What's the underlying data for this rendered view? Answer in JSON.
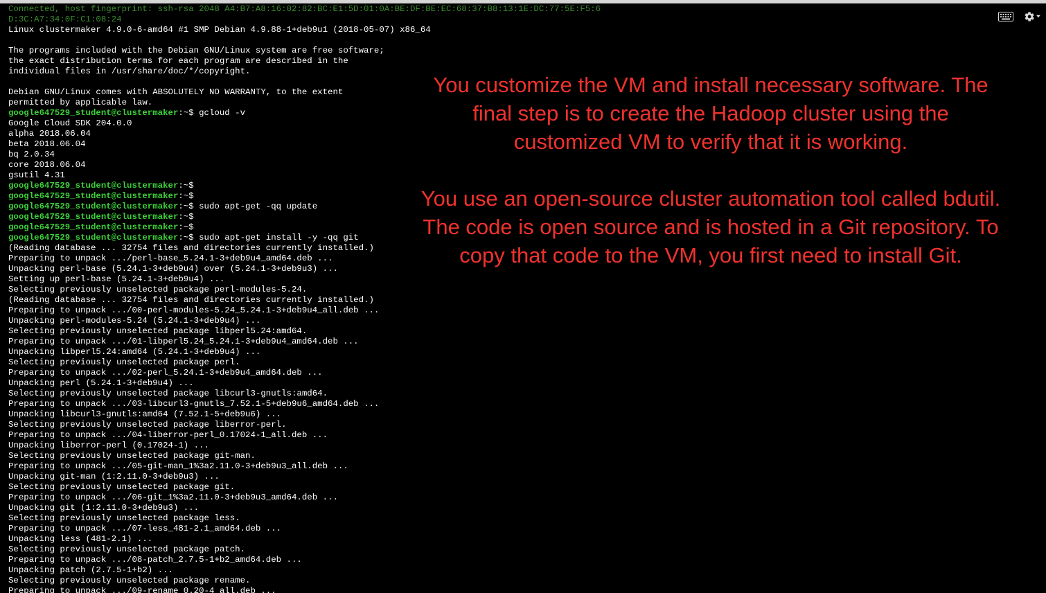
{
  "toolbar": {
    "keyboard_icon": "keyboard-icon",
    "settings_icon": "gear-icon"
  },
  "colors": {
    "background": "#000000",
    "terminal_text": "#ffffff",
    "prompt_user": "#3dd13a",
    "connection_text": "#3c8c2e",
    "overlay_text": "#f0322e"
  },
  "terminal": {
    "lines": [
      {
        "type": "conn",
        "text": "Connected, host fingerprint: ssh-rsa 2048 A4:B7:A8:16:02:82:BC:E1:5D:01:0A:BE:DF:BE:EC:68:37:B8:13:1E:DC:77:5E:F5:6"
      },
      {
        "type": "conn",
        "text": "D:3C:A7:34:0F:C1:08:24"
      },
      {
        "type": "out",
        "text": "Linux clustermaker 4.9.0-6-amd64 #1 SMP Debian 4.9.88-1+deb9u1 (2018-05-07) x86_64"
      },
      {
        "type": "out",
        "text": ""
      },
      {
        "type": "out",
        "text": "The programs included with the Debian GNU/Linux system are free software;"
      },
      {
        "type": "out",
        "text": "the exact distribution terms for each program are described in the"
      },
      {
        "type": "out",
        "text": "individual files in /usr/share/doc/*/copyright."
      },
      {
        "type": "out",
        "text": ""
      },
      {
        "type": "out",
        "text": "Debian GNU/Linux comes with ABSOLUTELY NO WARRANTY, to the extent"
      },
      {
        "type": "out",
        "text": "permitted by applicable law."
      },
      {
        "type": "prompt",
        "user": "google647529_student@clustermaker",
        "sep": ":~$",
        "cmd": " gcloud -v"
      },
      {
        "type": "out",
        "text": "Google Cloud SDK 204.0.0"
      },
      {
        "type": "out",
        "text": "alpha 2018.06.04"
      },
      {
        "type": "out",
        "text": "beta 2018.06.04"
      },
      {
        "type": "out",
        "text": "bq 2.0.34"
      },
      {
        "type": "out",
        "text": "core 2018.06.04"
      },
      {
        "type": "out",
        "text": "gsutil 4.31"
      },
      {
        "type": "prompt",
        "user": "google647529_student@clustermaker",
        "sep": ":~$",
        "cmd": ""
      },
      {
        "type": "prompt",
        "user": "google647529_student@clustermaker",
        "sep": ":~$",
        "cmd": ""
      },
      {
        "type": "prompt",
        "user": "google647529_student@clustermaker",
        "sep": ":~$",
        "cmd": " sudo apt-get -qq update"
      },
      {
        "type": "prompt",
        "user": "google647529_student@clustermaker",
        "sep": ":~$",
        "cmd": ""
      },
      {
        "type": "prompt",
        "user": "google647529_student@clustermaker",
        "sep": ":~$",
        "cmd": ""
      },
      {
        "type": "prompt",
        "user": "google647529_student@clustermaker",
        "sep": ":~$",
        "cmd": " sudo apt-get install -y -qq git"
      },
      {
        "type": "out",
        "text": "(Reading database ... 32754 files and directories currently installed.)"
      },
      {
        "type": "out",
        "text": "Preparing to unpack .../perl-base_5.24.1-3+deb9u4_amd64.deb ..."
      },
      {
        "type": "out",
        "text": "Unpacking perl-base (5.24.1-3+deb9u4) over (5.24.1-3+deb9u3) ..."
      },
      {
        "type": "out",
        "text": "Setting up perl-base (5.24.1-3+deb9u4) ..."
      },
      {
        "type": "out",
        "text": "Selecting previously unselected package perl-modules-5.24."
      },
      {
        "type": "out",
        "text": "(Reading database ... 32754 files and directories currently installed.)"
      },
      {
        "type": "out",
        "text": "Preparing to unpack .../00-perl-modules-5.24_5.24.1-3+deb9u4_all.deb ..."
      },
      {
        "type": "out",
        "text": "Unpacking perl-modules-5.24 (5.24.1-3+deb9u4) ..."
      },
      {
        "type": "out",
        "text": "Selecting previously unselected package libperl5.24:amd64."
      },
      {
        "type": "out",
        "text": "Preparing to unpack .../01-libperl5.24_5.24.1-3+deb9u4_amd64.deb ..."
      },
      {
        "type": "out",
        "text": "Unpacking libperl5.24:amd64 (5.24.1-3+deb9u4) ..."
      },
      {
        "type": "out",
        "text": "Selecting previously unselected package perl."
      },
      {
        "type": "out",
        "text": "Preparing to unpack .../02-perl_5.24.1-3+deb9u4_amd64.deb ..."
      },
      {
        "type": "out",
        "text": "Unpacking perl (5.24.1-3+deb9u4) ..."
      },
      {
        "type": "out",
        "text": "Selecting previously unselected package libcurl3-gnutls:amd64."
      },
      {
        "type": "out",
        "text": "Preparing to unpack .../03-libcurl3-gnutls_7.52.1-5+deb9u6_amd64.deb ..."
      },
      {
        "type": "out",
        "text": "Unpacking libcurl3-gnutls:amd64 (7.52.1-5+deb9u6) ..."
      },
      {
        "type": "out",
        "text": "Selecting previously unselected package liberror-perl."
      },
      {
        "type": "out",
        "text": "Preparing to unpack .../04-liberror-perl_0.17024-1_all.deb ..."
      },
      {
        "type": "out",
        "text": "Unpacking liberror-perl (0.17024-1) ..."
      },
      {
        "type": "out",
        "text": "Selecting previously unselected package git-man."
      },
      {
        "type": "out",
        "text": "Preparing to unpack .../05-git-man_1%3a2.11.0-3+deb9u3_all.deb ..."
      },
      {
        "type": "out",
        "text": "Unpacking git-man (1:2.11.0-3+deb9u3) ..."
      },
      {
        "type": "out",
        "text": "Selecting previously unselected package git."
      },
      {
        "type": "out",
        "text": "Preparing to unpack .../06-git_1%3a2.11.0-3+deb9u3_amd64.deb ..."
      },
      {
        "type": "out",
        "text": "Unpacking git (1:2.11.0-3+deb9u3) ..."
      },
      {
        "type": "out",
        "text": "Selecting previously unselected package less."
      },
      {
        "type": "out",
        "text": "Preparing to unpack .../07-less_481-2.1_amd64.deb ..."
      },
      {
        "type": "out",
        "text": "Unpacking less (481-2.1) ..."
      },
      {
        "type": "out",
        "text": "Selecting previously unselected package patch."
      },
      {
        "type": "out",
        "text": "Preparing to unpack .../08-patch_2.7.5-1+b2_amd64.deb ..."
      },
      {
        "type": "out",
        "text": "Unpacking patch (2.7.5-1+b2) ..."
      },
      {
        "type": "out",
        "text": "Selecting previously unselected package rename."
      },
      {
        "type": "out",
        "text": "Preparing to unpack .../09-rename_0.20-4_all.deb ..."
      }
    ]
  },
  "overlay": {
    "paragraph_1": "You customize the VM and install necessary software. The final step is to create the Hadoop cluster using the customized VM to verify that it is working.",
    "paragraph_2": "You use an open-source cluster automation tool called bdutil. The code is open source and is hosted in a Git repository. To copy that code to the VM, you first need to install Git."
  }
}
